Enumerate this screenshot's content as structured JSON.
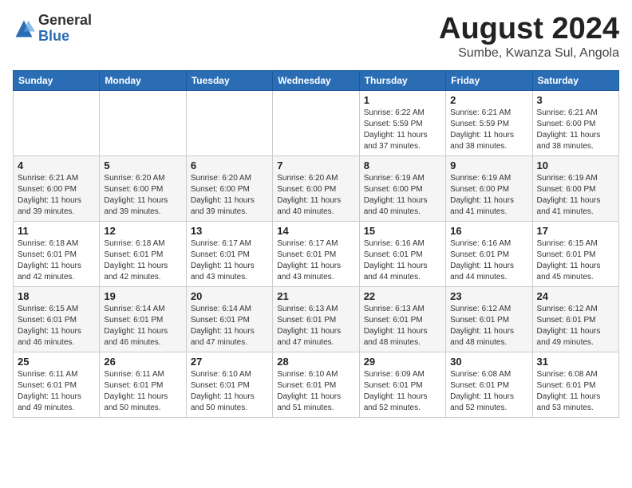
{
  "logo": {
    "general": "General",
    "blue": "Blue"
  },
  "title": "August 2024",
  "location": "Sumbe, Kwanza Sul, Angola",
  "days_header": [
    "Sunday",
    "Monday",
    "Tuesday",
    "Wednesday",
    "Thursday",
    "Friday",
    "Saturday"
  ],
  "weeks": [
    [
      {
        "day": "",
        "info": ""
      },
      {
        "day": "",
        "info": ""
      },
      {
        "day": "",
        "info": ""
      },
      {
        "day": "",
        "info": ""
      },
      {
        "day": "1",
        "info": "Sunrise: 6:22 AM\nSunset: 5:59 PM\nDaylight: 11 hours\nand 37 minutes."
      },
      {
        "day": "2",
        "info": "Sunrise: 6:21 AM\nSunset: 5:59 PM\nDaylight: 11 hours\nand 38 minutes."
      },
      {
        "day": "3",
        "info": "Sunrise: 6:21 AM\nSunset: 6:00 PM\nDaylight: 11 hours\nand 38 minutes."
      }
    ],
    [
      {
        "day": "4",
        "info": "Sunrise: 6:21 AM\nSunset: 6:00 PM\nDaylight: 11 hours\nand 39 minutes."
      },
      {
        "day": "5",
        "info": "Sunrise: 6:20 AM\nSunset: 6:00 PM\nDaylight: 11 hours\nand 39 minutes."
      },
      {
        "day": "6",
        "info": "Sunrise: 6:20 AM\nSunset: 6:00 PM\nDaylight: 11 hours\nand 39 minutes."
      },
      {
        "day": "7",
        "info": "Sunrise: 6:20 AM\nSunset: 6:00 PM\nDaylight: 11 hours\nand 40 minutes."
      },
      {
        "day": "8",
        "info": "Sunrise: 6:19 AM\nSunset: 6:00 PM\nDaylight: 11 hours\nand 40 minutes."
      },
      {
        "day": "9",
        "info": "Sunrise: 6:19 AM\nSunset: 6:00 PM\nDaylight: 11 hours\nand 41 minutes."
      },
      {
        "day": "10",
        "info": "Sunrise: 6:19 AM\nSunset: 6:00 PM\nDaylight: 11 hours\nand 41 minutes."
      }
    ],
    [
      {
        "day": "11",
        "info": "Sunrise: 6:18 AM\nSunset: 6:01 PM\nDaylight: 11 hours\nand 42 minutes."
      },
      {
        "day": "12",
        "info": "Sunrise: 6:18 AM\nSunset: 6:01 PM\nDaylight: 11 hours\nand 42 minutes."
      },
      {
        "day": "13",
        "info": "Sunrise: 6:17 AM\nSunset: 6:01 PM\nDaylight: 11 hours\nand 43 minutes."
      },
      {
        "day": "14",
        "info": "Sunrise: 6:17 AM\nSunset: 6:01 PM\nDaylight: 11 hours\nand 43 minutes."
      },
      {
        "day": "15",
        "info": "Sunrise: 6:16 AM\nSunset: 6:01 PM\nDaylight: 11 hours\nand 44 minutes."
      },
      {
        "day": "16",
        "info": "Sunrise: 6:16 AM\nSunset: 6:01 PM\nDaylight: 11 hours\nand 44 minutes."
      },
      {
        "day": "17",
        "info": "Sunrise: 6:15 AM\nSunset: 6:01 PM\nDaylight: 11 hours\nand 45 minutes."
      }
    ],
    [
      {
        "day": "18",
        "info": "Sunrise: 6:15 AM\nSunset: 6:01 PM\nDaylight: 11 hours\nand 46 minutes."
      },
      {
        "day": "19",
        "info": "Sunrise: 6:14 AM\nSunset: 6:01 PM\nDaylight: 11 hours\nand 46 minutes."
      },
      {
        "day": "20",
        "info": "Sunrise: 6:14 AM\nSunset: 6:01 PM\nDaylight: 11 hours\nand 47 minutes."
      },
      {
        "day": "21",
        "info": "Sunrise: 6:13 AM\nSunset: 6:01 PM\nDaylight: 11 hours\nand 47 minutes."
      },
      {
        "day": "22",
        "info": "Sunrise: 6:13 AM\nSunset: 6:01 PM\nDaylight: 11 hours\nand 48 minutes."
      },
      {
        "day": "23",
        "info": "Sunrise: 6:12 AM\nSunset: 6:01 PM\nDaylight: 11 hours\nand 48 minutes."
      },
      {
        "day": "24",
        "info": "Sunrise: 6:12 AM\nSunset: 6:01 PM\nDaylight: 11 hours\nand 49 minutes."
      }
    ],
    [
      {
        "day": "25",
        "info": "Sunrise: 6:11 AM\nSunset: 6:01 PM\nDaylight: 11 hours\nand 49 minutes."
      },
      {
        "day": "26",
        "info": "Sunrise: 6:11 AM\nSunset: 6:01 PM\nDaylight: 11 hours\nand 50 minutes."
      },
      {
        "day": "27",
        "info": "Sunrise: 6:10 AM\nSunset: 6:01 PM\nDaylight: 11 hours\nand 50 minutes."
      },
      {
        "day": "28",
        "info": "Sunrise: 6:10 AM\nSunset: 6:01 PM\nDaylight: 11 hours\nand 51 minutes."
      },
      {
        "day": "29",
        "info": "Sunrise: 6:09 AM\nSunset: 6:01 PM\nDaylight: 11 hours\nand 52 minutes."
      },
      {
        "day": "30",
        "info": "Sunrise: 6:08 AM\nSunset: 6:01 PM\nDaylight: 11 hours\nand 52 minutes."
      },
      {
        "day": "31",
        "info": "Sunrise: 6:08 AM\nSunset: 6:01 PM\nDaylight: 11 hours\nand 53 minutes."
      }
    ]
  ]
}
